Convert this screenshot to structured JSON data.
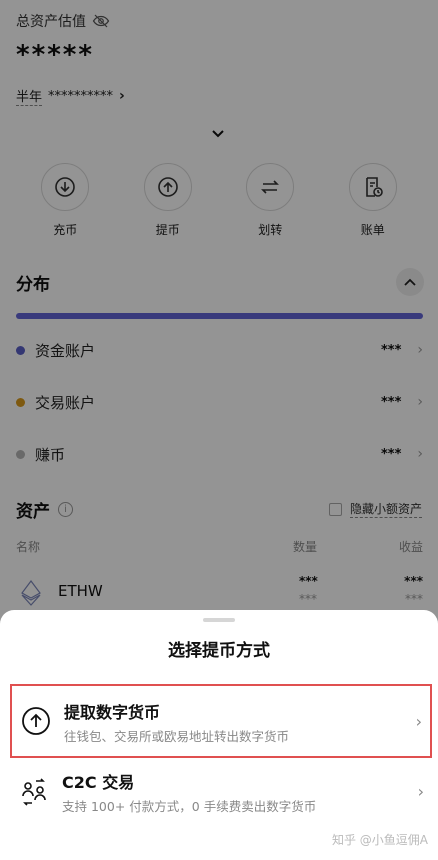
{
  "assets_header": {
    "title": "总资产估值",
    "masked_value": "*****",
    "period_label": "半年",
    "period_value": "**********",
    "expand_icon": "chevron-down-icon"
  },
  "actions": [
    {
      "label": "充币",
      "icon": "deposit-icon"
    },
    {
      "label": "提币",
      "icon": "withdraw-icon"
    },
    {
      "label": "划转",
      "icon": "transfer-icon"
    },
    {
      "label": "账单",
      "icon": "bill-icon"
    }
  ],
  "distribution": {
    "title": "分布",
    "bar_color": "#6265d6",
    "accounts": [
      {
        "name": "资金账户",
        "value": "***",
        "color": "#5b5fc7"
      },
      {
        "name": "交易账户",
        "value": "***",
        "color": "#d99a1c"
      },
      {
        "name": "赚币",
        "value": "***",
        "color": "#b5b5b5"
      }
    ]
  },
  "asset_list": {
    "title": "资产",
    "hide_small_label": "隐藏小额资产",
    "columns": [
      "名称",
      "数量",
      "收益"
    ],
    "rows": [
      {
        "name": "ETHW",
        "qty": "***",
        "qty_sub": "***",
        "pnl": "***",
        "pnl_sub": "***"
      }
    ]
  },
  "sheet": {
    "title": "选择提币方式",
    "options": [
      {
        "title": "提取数字货币",
        "desc": "往钱包、交易所或欧易地址转出数字货币",
        "icon": "upload-circle-icon"
      },
      {
        "title": "C2C 交易",
        "desc": "支持 100+ 付款方式，0 手续费卖出数字货币",
        "icon": "c2c-people-icon"
      }
    ]
  },
  "watermark": "知乎 @小鱼逗佣A",
  "highlight_color": "#e05050"
}
